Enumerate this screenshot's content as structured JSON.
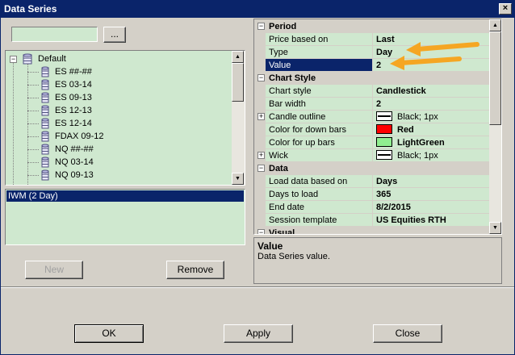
{
  "window": {
    "title": "Data Series",
    "close_glyph": "×"
  },
  "search": {
    "value": "",
    "browse_label": "..."
  },
  "tree": {
    "root": {
      "label": "Default",
      "icon": "database-icon"
    },
    "items": [
      {
        "label": "ES ##-##"
      },
      {
        "label": "ES 03-14"
      },
      {
        "label": "ES 09-13"
      },
      {
        "label": "ES 12-13"
      },
      {
        "label": "ES 12-14"
      },
      {
        "label": "FDAX 09-12"
      },
      {
        "label": "NQ ##-##"
      },
      {
        "label": "NQ 03-14"
      },
      {
        "label": "NQ 09-13"
      }
    ]
  },
  "series_list": {
    "items": [
      {
        "label": "IWM (2 Day)"
      }
    ]
  },
  "buttons": {
    "new": "New",
    "remove": "Remove",
    "ok": "OK",
    "apply": "Apply",
    "close": "Close"
  },
  "properties": {
    "period": {
      "label": "Period",
      "rows": [
        {
          "name": "Price based on",
          "value": "Last"
        },
        {
          "name": "Type",
          "value": "Day"
        },
        {
          "name": "Value",
          "value": "2"
        }
      ]
    },
    "chart_style": {
      "label": "Chart Style",
      "rows": [
        {
          "name": "Chart style",
          "value": "Candlestick"
        },
        {
          "name": "Bar width",
          "value": "2"
        },
        {
          "name": "Candle outline",
          "value": "Black; 1px"
        },
        {
          "name": "Color for down bars",
          "value": "Red",
          "color": "#ff0000"
        },
        {
          "name": "Color for up bars",
          "value": "LightGreen",
          "color": "#90ee90"
        },
        {
          "name": "Wick",
          "value": "Black; 1px"
        }
      ]
    },
    "data": {
      "label": "Data",
      "rows": [
        {
          "name": "Load data based on",
          "value": "Days"
        },
        {
          "name": "Days to load",
          "value": "365"
        },
        {
          "name": "End date",
          "value": "8/2/2015"
        },
        {
          "name": "Session template",
          "value": "US Equities RTH"
        }
      ]
    },
    "visual": {
      "label": "Visual"
    }
  },
  "description": {
    "title": "Value",
    "text": "Data Series value."
  },
  "colors": {
    "title_bar": "#0a246a",
    "grid_green": "#cfe8cf",
    "highlight_arrow": "#f5a623"
  }
}
